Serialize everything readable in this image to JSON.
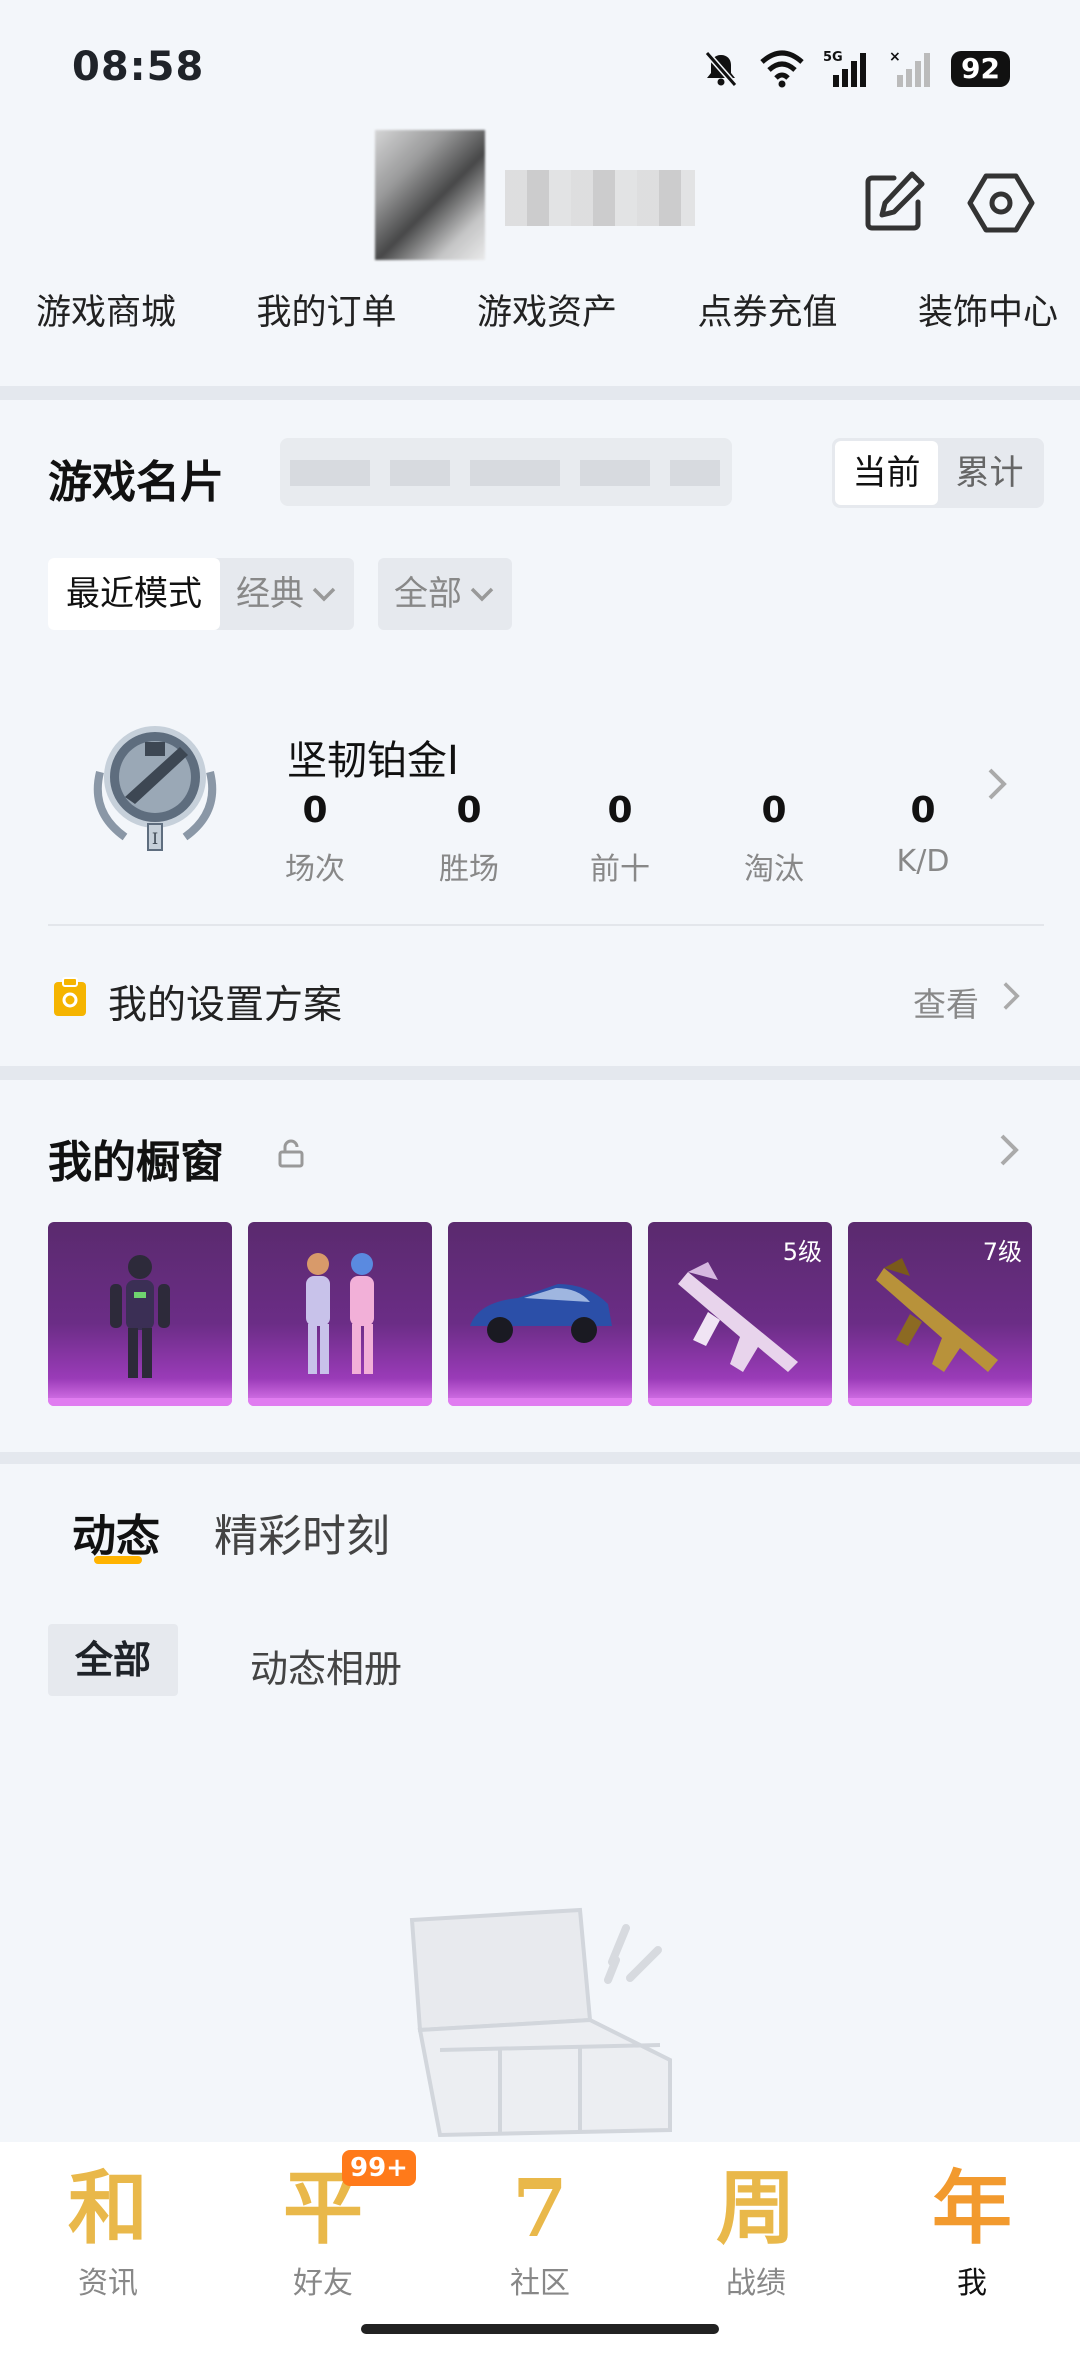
{
  "status_bar": {
    "time": "08:58",
    "battery": "92",
    "net": "5G"
  },
  "nav": {
    "items": [
      "游戏商城",
      "我的订单",
      "游戏资产",
      "点券充值",
      "装饰中心"
    ]
  },
  "game_card": {
    "title": "游戏名片",
    "segment": [
      "当前",
      "累计"
    ],
    "filters": {
      "recent": "最近模式",
      "classic": "经典",
      "all": "全部"
    },
    "rank_name": "坚韧铂金Ⅰ",
    "stats": [
      {
        "label": "场次",
        "value": "0"
      },
      {
        "label": "胜场",
        "value": "0"
      },
      {
        "label": "前十",
        "value": "0"
      },
      {
        "label": "淘汰",
        "value": "0"
      },
      {
        "label": "K/D",
        "value": "0"
      }
    ],
    "plan": {
      "label": "我的设置方案",
      "view": "查看"
    }
  },
  "showcase": {
    "title": "我的橱窗",
    "tiles": [
      {
        "icon": "mecha-suit-icon",
        "level": ""
      },
      {
        "icon": "twin-suits-icon",
        "level": ""
      },
      {
        "icon": "sports-car-icon",
        "level": ""
      },
      {
        "icon": "gun-skin-pink-icon",
        "level": "5级"
      },
      {
        "icon": "gun-skin-gold-icon",
        "level": "7级"
      }
    ]
  },
  "feed": {
    "tabs": [
      "动态",
      "精彩时刻"
    ],
    "sub_tabs": [
      "全部",
      "动态相册"
    ]
  },
  "tabbar": {
    "items": [
      {
        "glyph": "和",
        "label": "资讯"
      },
      {
        "glyph": "平",
        "label": "好友"
      },
      {
        "glyph": "7",
        "label": "社区"
      },
      {
        "glyph": "周",
        "label": "战绩"
      },
      {
        "glyph": "年",
        "label": "我"
      }
    ],
    "friends_badge": "99+"
  },
  "colors": {
    "accent": "#ffb300",
    "badge": "#ff7a1a",
    "tile_purple": "#6b2d86"
  }
}
